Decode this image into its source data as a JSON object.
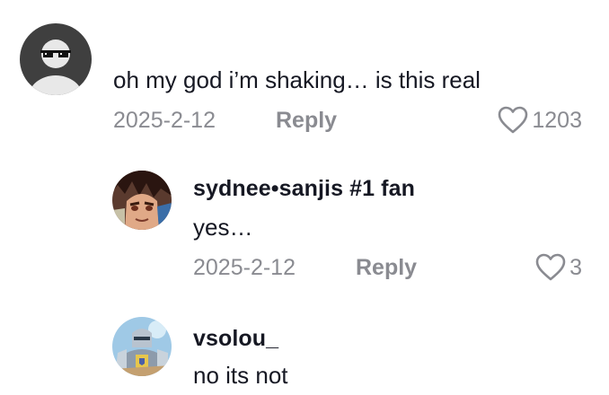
{
  "comments": [
    {
      "text": "oh my god i’m shaking… is this real",
      "date": "2025-2-12",
      "reply_label": "Reply",
      "like_count": "1203",
      "avatar_icon": "default-avatar-with-sunglasses"
    }
  ],
  "replies": [
    {
      "username": "sydnee•sanjis #1 fan",
      "text": "yes…",
      "date": "2025-2-12",
      "reply_label": "Reply",
      "like_count": "3",
      "avatar_icon": "anime-character-avatar"
    },
    {
      "username": "vsolou_",
      "text": "no its not",
      "avatar_icon": "armored-knight-avatar"
    }
  ],
  "colors": {
    "text_primary": "#161823",
    "text_secondary": "#8a8b91",
    "background": "#ffffff"
  }
}
